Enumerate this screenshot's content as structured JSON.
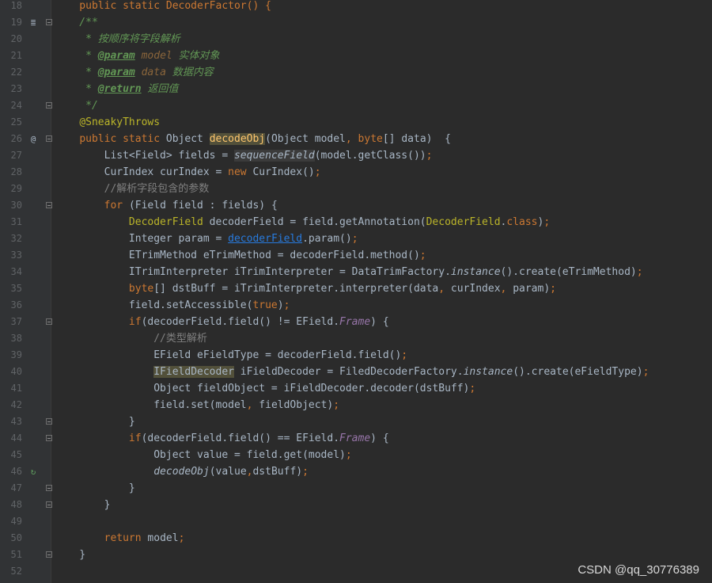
{
  "editor": {
    "lines": [
      {
        "no": "18",
        "fold": false,
        "marker": "",
        "tokens": [
          {
            "t": "    public static DecoderFactor() {",
            "c": "tk-kw"
          }
        ]
      },
      {
        "no": "19",
        "fold": true,
        "marker": "≣",
        "tokens": [
          {
            "t": "    /**",
            "c": "tk-doc"
          }
        ]
      },
      {
        "no": "20",
        "fold": false,
        "marker": "",
        "tokens": [
          {
            "t": "     * 按顺序将字段解析",
            "c": "tk-doc"
          }
        ]
      },
      {
        "no": "21",
        "fold": false,
        "marker": "",
        "tokens": [
          {
            "t": "     * ",
            "c": "tk-doc"
          },
          {
            "t": "@param",
            "c": "tk-doctag"
          },
          {
            "t": " model",
            "c": "tk-docparam"
          },
          {
            "t": " 实体对象",
            "c": "tk-doc"
          }
        ]
      },
      {
        "no": "22",
        "fold": false,
        "marker": "",
        "tokens": [
          {
            "t": "     * ",
            "c": "tk-doc"
          },
          {
            "t": "@param",
            "c": "tk-doctag"
          },
          {
            "t": " data",
            "c": "tk-docparam"
          },
          {
            "t": " 数据内容",
            "c": "tk-doc"
          }
        ]
      },
      {
        "no": "23",
        "fold": false,
        "marker": "",
        "tokens": [
          {
            "t": "     * ",
            "c": "tk-doc"
          },
          {
            "t": "@return",
            "c": "tk-doctag"
          },
          {
            "t": " 返回值",
            "c": "tk-doc"
          }
        ]
      },
      {
        "no": "24",
        "fold": true,
        "marker": "",
        "tokens": [
          {
            "t": "     */",
            "c": "tk-doc"
          }
        ]
      },
      {
        "no": "25",
        "fold": false,
        "marker": "",
        "tokens": [
          {
            "t": "    ",
            "c": ""
          },
          {
            "t": "@SneakyThrows",
            "c": "tk-ann"
          }
        ]
      },
      {
        "no": "26",
        "fold": true,
        "marker": "@",
        "tokens": [
          {
            "t": "    ",
            "c": ""
          },
          {
            "t": "public static ",
            "c": "tk-kw"
          },
          {
            "t": "Object ",
            "c": ""
          },
          {
            "t": "decodeObj",
            "c": "tk-method tk-hl"
          },
          {
            "t": "(Object model",
            "c": ""
          },
          {
            "t": ", ",
            "c": "tk-kw"
          },
          {
            "t": "byte",
            "c": "tk-kw"
          },
          {
            "t": "[] data)  {",
            "c": ""
          }
        ]
      },
      {
        "no": "27",
        "fold": false,
        "marker": "",
        "tokens": [
          {
            "t": "        List<Field> fields = ",
            "c": ""
          },
          {
            "t": "sequenceField",
            "c": "tk-ital tk-type"
          },
          {
            "t": "(model.getClass())",
            "c": ""
          },
          {
            "t": ";",
            "c": "tk-kw"
          }
        ]
      },
      {
        "no": "28",
        "fold": false,
        "marker": "",
        "tokens": [
          {
            "t": "        CurIndex curIndex = ",
            "c": ""
          },
          {
            "t": "new ",
            "c": "tk-kw"
          },
          {
            "t": "CurIndex()",
            "c": ""
          },
          {
            "t": ";",
            "c": "tk-kw"
          }
        ]
      },
      {
        "no": "29",
        "fold": false,
        "marker": "",
        "tokens": [
          {
            "t": "        //解析字段包含的参数",
            "c": "tk-cmt"
          }
        ]
      },
      {
        "no": "30",
        "fold": true,
        "marker": "",
        "tokens": [
          {
            "t": "        ",
            "c": ""
          },
          {
            "t": "for ",
            "c": "tk-kw"
          },
          {
            "t": "(Field field : fields) {",
            "c": ""
          }
        ]
      },
      {
        "no": "31",
        "fold": false,
        "marker": "",
        "tokens": [
          {
            "t": "            ",
            "c": ""
          },
          {
            "t": "DecoderField",
            "c": "tk-cls"
          },
          {
            "t": " decoderField = field.getAnnotation(",
            "c": ""
          },
          {
            "t": "DecoderField",
            "c": "tk-cls"
          },
          {
            "t": ".",
            "c": ""
          },
          {
            "t": "class",
            "c": "tk-kw"
          },
          {
            "t": ")",
            "c": ""
          },
          {
            "t": ";",
            "c": "tk-kw"
          }
        ]
      },
      {
        "no": "32",
        "fold": false,
        "marker": "",
        "tokens": [
          {
            "t": "            Integer param = ",
            "c": ""
          },
          {
            "t": "decoderField",
            "c": "tk-link"
          },
          {
            "t": ".param()",
            "c": ""
          },
          {
            "t": ";",
            "c": "tk-kw"
          }
        ]
      },
      {
        "no": "33",
        "fold": false,
        "marker": "",
        "tokens": [
          {
            "t": "            ETrimMethod eTrimMethod = decoderField.method()",
            "c": ""
          },
          {
            "t": ";",
            "c": "tk-kw"
          }
        ]
      },
      {
        "no": "34",
        "fold": false,
        "marker": "",
        "tokens": [
          {
            "t": "            ITrimInterpreter iTrimInterpreter = DataTrimFactory.",
            "c": ""
          },
          {
            "t": "instance",
            "c": "tk-ital"
          },
          {
            "t": "().create(eTrimMethod)",
            "c": ""
          },
          {
            "t": ";",
            "c": "tk-kw"
          }
        ]
      },
      {
        "no": "35",
        "fold": false,
        "marker": "",
        "tokens": [
          {
            "t": "            ",
            "c": ""
          },
          {
            "t": "byte",
            "c": "tk-kw"
          },
          {
            "t": "[] dstBuff = iTrimInterpreter.interpreter(data",
            "c": ""
          },
          {
            "t": ", ",
            "c": "tk-kw"
          },
          {
            "t": "curIndex",
            "c": ""
          },
          {
            "t": ", ",
            "c": "tk-kw"
          },
          {
            "t": "param)",
            "c": ""
          },
          {
            "t": ";",
            "c": "tk-kw"
          }
        ]
      },
      {
        "no": "36",
        "fold": false,
        "marker": "",
        "tokens": [
          {
            "t": "            field.setAccessible(",
            "c": ""
          },
          {
            "t": "true",
            "c": "tk-kw"
          },
          {
            "t": ")",
            "c": ""
          },
          {
            "t": ";",
            "c": "tk-kw"
          }
        ]
      },
      {
        "no": "37",
        "fold": true,
        "marker": "",
        "tokens": [
          {
            "t": "            ",
            "c": ""
          },
          {
            "t": "if",
            "c": "tk-kw"
          },
          {
            "t": "(decoderField.field() != EField.",
            "c": ""
          },
          {
            "t": "Frame",
            "c": "tk-const"
          },
          {
            "t": ") {",
            "c": ""
          }
        ]
      },
      {
        "no": "38",
        "fold": false,
        "marker": "",
        "tokens": [
          {
            "t": "                //类型解析",
            "c": "tk-cmt"
          }
        ]
      },
      {
        "no": "39",
        "fold": false,
        "marker": "",
        "tokens": [
          {
            "t": "                EField eFieldType = decoderField.field()",
            "c": ""
          },
          {
            "t": ";",
            "c": "tk-kw"
          }
        ]
      },
      {
        "no": "40",
        "fold": false,
        "marker": "",
        "tokens": [
          {
            "t": "                ",
            "c": ""
          },
          {
            "t": "IFieldDecoder",
            "c": "tk-hl"
          },
          {
            "t": " iFieldDecoder = FiledDecoderFactory.",
            "c": ""
          },
          {
            "t": "instance",
            "c": "tk-ital"
          },
          {
            "t": "().create(eFieldType)",
            "c": ""
          },
          {
            "t": ";",
            "c": "tk-kw"
          }
        ]
      },
      {
        "no": "41",
        "fold": false,
        "marker": "",
        "tokens": [
          {
            "t": "                Object fieldObject = iFieldDecoder.decoder(dstBuff)",
            "c": ""
          },
          {
            "t": ";",
            "c": "tk-kw"
          }
        ]
      },
      {
        "no": "42",
        "fold": false,
        "marker": "",
        "tokens": [
          {
            "t": "                field.set(model",
            "c": ""
          },
          {
            "t": ", ",
            "c": "tk-kw"
          },
          {
            "t": "fieldObject)",
            "c": ""
          },
          {
            "t": ";",
            "c": "tk-kw"
          }
        ]
      },
      {
        "no": "43",
        "fold": true,
        "marker": "",
        "tokens": [
          {
            "t": "            }",
            "c": ""
          }
        ]
      },
      {
        "no": "44",
        "fold": true,
        "marker": "",
        "tokens": [
          {
            "t": "            ",
            "c": ""
          },
          {
            "t": "if",
            "c": "tk-kw"
          },
          {
            "t": "(decoderField.field() == EField.",
            "c": ""
          },
          {
            "t": "Frame",
            "c": "tk-const"
          },
          {
            "t": ") {",
            "c": ""
          }
        ]
      },
      {
        "no": "45",
        "fold": false,
        "marker": "",
        "tokens": [
          {
            "t": "                Object value = field.get(model)",
            "c": ""
          },
          {
            "t": ";",
            "c": "tk-kw"
          }
        ]
      },
      {
        "no": "46",
        "fold": false,
        "marker": "↻",
        "tokens": [
          {
            "t": "                ",
            "c": ""
          },
          {
            "t": "decodeObj",
            "c": "tk-ital"
          },
          {
            "t": "(value",
            "c": ""
          },
          {
            "t": ",",
            "c": "tk-kw"
          },
          {
            "t": "dstBuff)",
            "c": ""
          },
          {
            "t": ";",
            "c": "tk-kw"
          }
        ]
      },
      {
        "no": "47",
        "fold": true,
        "marker": "",
        "tokens": [
          {
            "t": "            }",
            "c": ""
          }
        ]
      },
      {
        "no": "48",
        "fold": true,
        "marker": "",
        "tokens": [
          {
            "t": "        }",
            "c": ""
          }
        ]
      },
      {
        "no": "49",
        "fold": false,
        "marker": "",
        "tokens": []
      },
      {
        "no": "50",
        "fold": false,
        "marker": "",
        "tokens": [
          {
            "t": "        ",
            "c": ""
          },
          {
            "t": "return ",
            "c": "tk-kw"
          },
          {
            "t": "model",
            "c": ""
          },
          {
            "t": ";",
            "c": "tk-kw"
          }
        ]
      },
      {
        "no": "51",
        "fold": true,
        "marker": "",
        "tokens": [
          {
            "t": "    }",
            "c": ""
          }
        ]
      },
      {
        "no": "52",
        "fold": false,
        "marker": "",
        "tokens": []
      }
    ]
  },
  "watermark": "CSDN @qq_30776389"
}
